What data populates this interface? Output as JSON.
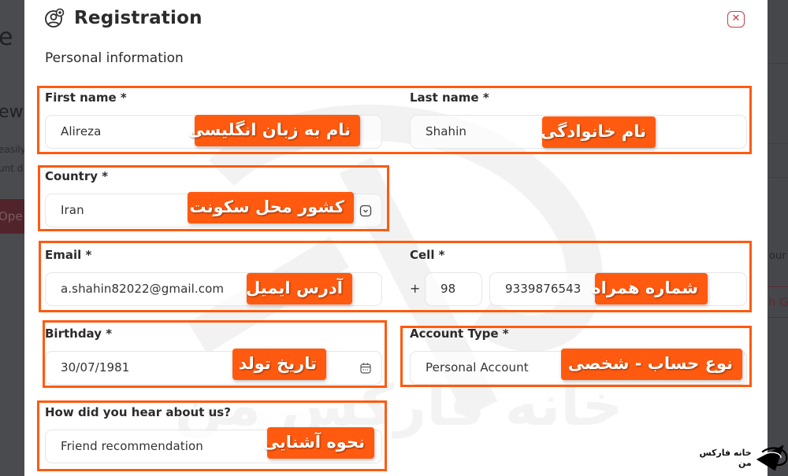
{
  "background": {
    "left_fragments": [
      "e",
      "ew",
      "easily",
      "unt d",
      "Ope"
    ],
    "right_fragments": [
      "our",
      "h G"
    ]
  },
  "modal": {
    "title": "Registration",
    "title_icon": "user-add-icon",
    "close_icon": "close-icon",
    "section_title": "Personal information",
    "fields": {
      "first_name": {
        "label": "First name *",
        "value": "Alireza",
        "annotation": "نام به زبان انگلیسی"
      },
      "last_name": {
        "label": "Last name *",
        "value": "Shahin",
        "annotation": "نام خانوادگی"
      },
      "country": {
        "label": "Country *",
        "value": "Iran",
        "icon": "chevron-down-icon",
        "annotation": "کشور محل سکونت"
      },
      "email": {
        "label": "Email *",
        "value": "a.shahin82022@gmail.com",
        "annotation": "آدرس ایمیل"
      },
      "cell": {
        "label": "Cell *",
        "prefix": "+",
        "country_code": "98",
        "number": "9339876543",
        "annotation": "شماره همراه"
      },
      "birthday": {
        "label": "Birthday *",
        "value": "30/07/1981",
        "icon": "calendar-icon",
        "annotation": "تاریخ تولد"
      },
      "account_type": {
        "label": "Account Type *",
        "value": "Personal Account",
        "annotation": "نوع حساب - شخصی"
      },
      "referral": {
        "label": "How did you hear about us?",
        "value": "Friend recommendation",
        "annotation": "نحوه آشنایی"
      }
    }
  },
  "watermark": {
    "text": "خانه فارکس من"
  },
  "brand": {
    "text": "خانه فارکس من"
  },
  "colors": {
    "highlight": "#ff5a0f",
    "close": "#c2404a",
    "overlay": "#46474b"
  }
}
